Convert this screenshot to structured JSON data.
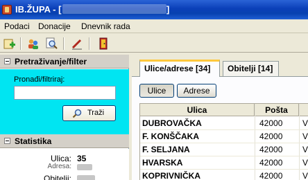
{
  "window": {
    "title": "IB.ŽUPA - [",
    "title_end": "]"
  },
  "menu": [
    "Podaci",
    "Donacije",
    "Dnevnik rada"
  ],
  "toolbar": {
    "icons": [
      "add-document-icon",
      "people-icon",
      "preview-icon",
      "edit-icon",
      "exit-door-icon"
    ]
  },
  "filter_panel": {
    "title": "Pretraživanje/filter",
    "label": "Pronađi/filtriraj:",
    "input_value": "",
    "search_button": "Traži"
  },
  "stats_panel": {
    "title": "Statistika",
    "street_label": "Ulica:",
    "street_value": "35",
    "address_label": "Adresa:",
    "family_label": "Obitelji:"
  },
  "tabs": [
    {
      "label": "Ulice/adrese [34]",
      "active": true
    },
    {
      "label": "Obitelji [14]",
      "active": false
    }
  ],
  "sub_buttons": [
    {
      "label": "Ulice",
      "pressed": true
    },
    {
      "label": "Adrese",
      "pressed": false
    }
  ],
  "grid": {
    "headers": [
      "Ulica",
      "Pošta"
    ],
    "rows": [
      {
        "street": "DUBROVAČKA",
        "post": "42000",
        "extra": "V"
      },
      {
        "street": "F. KONŠČAKA",
        "post": "42000",
        "extra": "V"
      },
      {
        "street": "F. SELJANA",
        "post": "42000",
        "extra": "V"
      },
      {
        "street": "HVARSKA",
        "post": "42000",
        "extra": "V"
      },
      {
        "street": "KOPRIVNIČKA",
        "post": "42000",
        "extra": "V"
      }
    ]
  },
  "colors": {
    "title_bar": "#0a3fb8",
    "filter_bg": "#00e5f2",
    "tab_accent": "#ffc83c"
  }
}
